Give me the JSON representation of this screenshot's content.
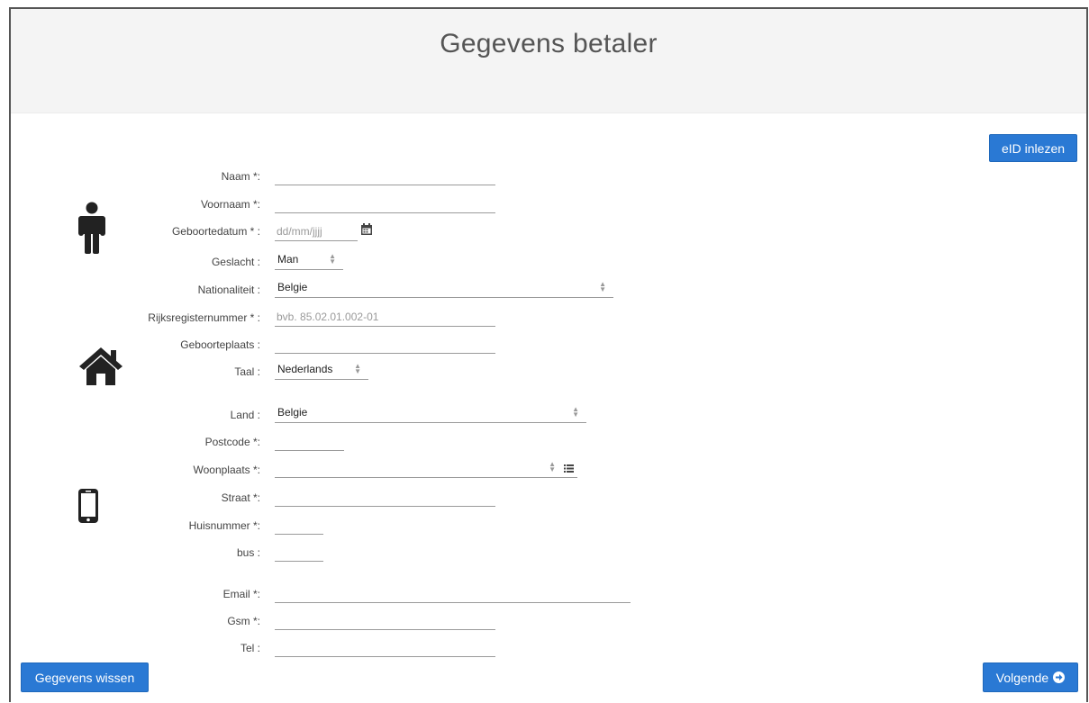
{
  "header": {
    "title": "Gegevens betaler"
  },
  "buttons": {
    "eid": "eID inlezen",
    "clear": "Gegevens wissen",
    "next": "Volgende"
  },
  "form": {
    "naam": {
      "label": "Naam *:",
      "value": ""
    },
    "voornaam": {
      "label": "Voornaam *:",
      "value": ""
    },
    "geboortedatum": {
      "label": "Geboortedatum * :",
      "placeholder": "dd/mm/jjjj"
    },
    "geslacht": {
      "label": "Geslacht :",
      "value": "Man"
    },
    "nationaliteit": {
      "label": "Nationaliteit :",
      "value": "Belgie"
    },
    "rijksregisternummer": {
      "label": "Rijksregisternummer * :",
      "placeholder": "bvb. 85.02.01.002-01"
    },
    "geboorteplaats": {
      "label": "Geboorteplaats :",
      "value": ""
    },
    "taal": {
      "label": "Taal :",
      "value": "Nederlands"
    },
    "land": {
      "label": "Land :",
      "value": "Belgie"
    },
    "postcode": {
      "label": "Postcode *:",
      "value": ""
    },
    "woonplaats": {
      "label": "Woonplaats *:",
      "value": ""
    },
    "straat": {
      "label": "Straat *:",
      "value": ""
    },
    "huisnummer": {
      "label": "Huisnummer *:",
      "value": ""
    },
    "bus": {
      "label": "bus :",
      "value": ""
    },
    "email": {
      "label": "Email *:",
      "value": ""
    },
    "gsm": {
      "label": "Gsm *:",
      "value": ""
    },
    "tel": {
      "label": "Tel :",
      "value": ""
    }
  },
  "icons": {
    "person": "person-icon",
    "home": "home-icon",
    "mobile": "mobile-phone-icon",
    "calendar": "calendar-icon",
    "list": "list-icon",
    "arrow": "arrow-circle-right-icon"
  },
  "colors": {
    "primary": "#2a79d4",
    "header_bg": "#f4f4f4"
  }
}
